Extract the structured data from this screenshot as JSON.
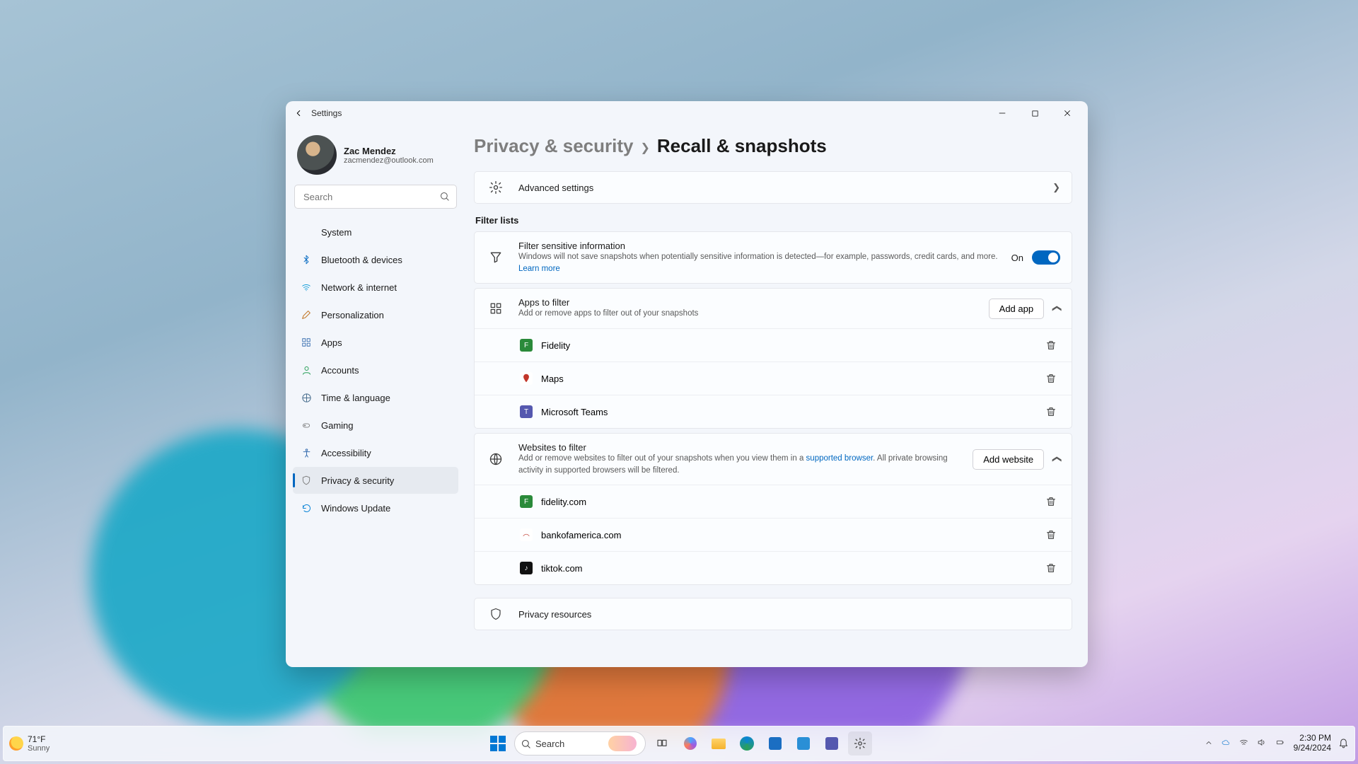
{
  "window": {
    "title": "Settings"
  },
  "profile": {
    "name": "Zac Mendez",
    "email": "zacmendez@outlook.com"
  },
  "search": {
    "placeholder": "Search"
  },
  "sidebar": {
    "items": [
      {
        "label": "System"
      },
      {
        "label": "Bluetooth & devices"
      },
      {
        "label": "Network & internet"
      },
      {
        "label": "Personalization"
      },
      {
        "label": "Apps"
      },
      {
        "label": "Accounts"
      },
      {
        "label": "Time & language"
      },
      {
        "label": "Gaming"
      },
      {
        "label": "Accessibility"
      },
      {
        "label": "Privacy & security"
      },
      {
        "label": "Windows Update"
      }
    ],
    "active_index": 9
  },
  "breadcrumb": {
    "parent": "Privacy & security",
    "current": "Recall & snapshots"
  },
  "advanced": {
    "label": "Advanced settings"
  },
  "filter_lists": {
    "heading": "Filter lists",
    "sensitive": {
      "title": "Filter sensitive information",
      "desc": "Windows will not save snapshots when potentially sensitive information is detected—for example, passwords, credit cards, and more.",
      "learn_more": "Learn more",
      "state_label": "On"
    },
    "apps": {
      "title": "Apps to filter",
      "desc": "Add or remove apps to filter out of your snapshots",
      "add_label": "Add app",
      "items": [
        {
          "name": "Fidelity",
          "color": "#2a8a3a"
        },
        {
          "name": "Maps",
          "color": "#c2362a"
        },
        {
          "name": "Microsoft Teams",
          "color": "#5558af"
        }
      ]
    },
    "websites": {
      "title": "Websites to filter",
      "desc_pre": "Add or remove websites to filter out of your snapshots when you view them in a ",
      "desc_link": "supported browser",
      "desc_post": ". All private browsing activity in supported browsers will be filtered.",
      "add_label": "Add website",
      "items": [
        {
          "name": "fidelity.com",
          "color": "#2a8a3a"
        },
        {
          "name": "bankofamerica.com",
          "color": "#c0392b"
        },
        {
          "name": "tiktok.com",
          "color": "#111111"
        }
      ]
    },
    "privacy_resources": {
      "title": "Privacy resources"
    }
  },
  "taskbar": {
    "weather": {
      "temp": "71°F",
      "cond": "Sunny"
    },
    "search_label": "Search",
    "clock": {
      "time": "2:30 PM",
      "date": "9/24/2024"
    }
  }
}
